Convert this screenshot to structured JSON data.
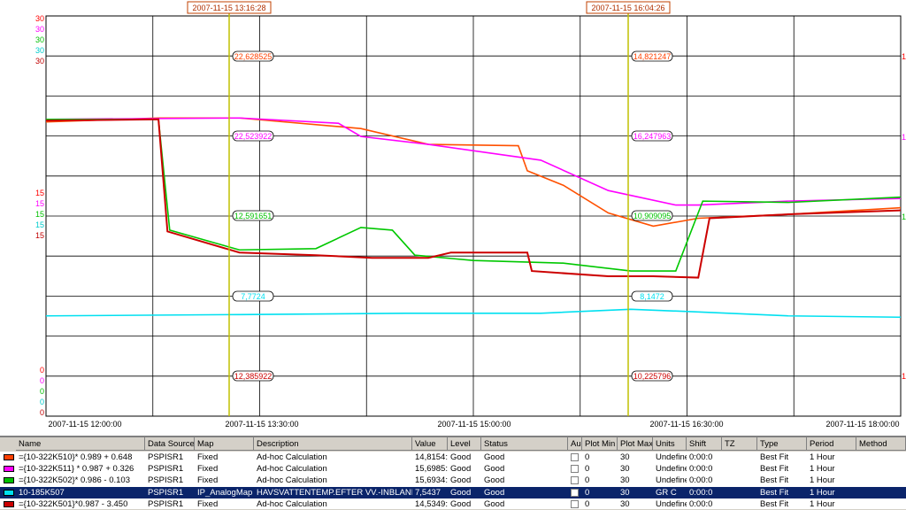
{
  "cursors": [
    {
      "time_label": "2007-11-15  13:16:28",
      "values": [
        "22,628525",
        "22,523922",
        "12,591651",
        "7,7724",
        "12,385922"
      ]
    },
    {
      "time_label": "2007-11-15  16:04:26",
      "values": [
        "14,821247",
        "16,247963",
        "10,909095",
        "8,1472",
        "10,225796"
      ]
    }
  ],
  "y_axis_groups": [
    {
      "label": "30",
      "color": "#ff0000"
    },
    {
      "label": "30",
      "color": "#ff00ff"
    },
    {
      "label": "30",
      "color": "#00c000"
    },
    {
      "label": "30",
      "color": "#00cccc"
    },
    {
      "label": "30",
      "color": "#c00000"
    },
    {
      "label": "15",
      "color": "#ff0000"
    },
    {
      "label": "15",
      "color": "#ff00ff"
    },
    {
      "label": "15",
      "color": "#00c000"
    },
    {
      "label": "15",
      "color": "#00cccc"
    },
    {
      "label": "15",
      "color": "#c00000"
    },
    {
      "label": "0",
      "color": "#ff0000"
    },
    {
      "label": "0",
      "color": "#ff00ff"
    },
    {
      "label": "0",
      "color": "#00c000"
    },
    {
      "label": "0",
      "color": "#00cccc"
    },
    {
      "label": "0",
      "color": "#c00000"
    }
  ],
  "right_axis_labels": [
    "1",
    "1",
    "1",
    "1"
  ],
  "x_ticks": [
    "2007-11-15  12:00:00",
    "2007-11-15  13:30:00",
    "2007-11-15  15:00:00",
    "2007-11-15  16:30:00",
    "2007-11-15  18:00:00"
  ],
  "chart_data": {
    "type": "line",
    "x_range": [
      "2007-11-15 11:50",
      "2007-11-15 18:10"
    ],
    "ylim": [
      0,
      30
    ],
    "grid": true,
    "series": [
      {
        "name": "={10-322K510}* 0.989 + 0.648",
        "color": "#ff5000",
        "points": [
          [
            "11:50",
            22.3
          ],
          [
            "12:40",
            22.6
          ],
          [
            "13:16",
            22.6
          ],
          [
            "14:10",
            21.8
          ],
          [
            "14:40",
            20.6
          ],
          [
            "15:20",
            20.5
          ],
          [
            "15:24",
            18.6
          ],
          [
            "15:40",
            17.5
          ],
          [
            "16:00",
            15.4
          ],
          [
            "16:20",
            14.4
          ],
          [
            "16:40",
            15.0
          ],
          [
            "17:20",
            15.3
          ],
          [
            "18:10",
            15.8
          ]
        ]
      },
      {
        "name": "={10-322K511} * 0.987 + 0.326",
        "color": "#ff00ff",
        "points": [
          [
            "11:50",
            22.5
          ],
          [
            "13:16",
            22.6
          ],
          [
            "14:00",
            22.2
          ],
          [
            "14:10",
            21.2
          ],
          [
            "14:40",
            20.6
          ],
          [
            "15:30",
            19.4
          ],
          [
            "16:00",
            17.1
          ],
          [
            "16:30",
            16.0
          ],
          [
            "16:40",
            16.0
          ],
          [
            "17:20",
            16.3
          ],
          [
            "18:10",
            16.5
          ]
        ]
      },
      {
        "name": "={10-322K502}* 0.986 - 0.103",
        "color": "#00c800",
        "points": [
          [
            "11:50",
            22.5
          ],
          [
            "12:40",
            22.5
          ],
          [
            "12:45",
            14.1
          ],
          [
            "13:16",
            12.6
          ],
          [
            "13:50",
            12.7
          ],
          [
            "14:10",
            14.3
          ],
          [
            "14:24",
            14.1
          ],
          [
            "14:34",
            12.2
          ],
          [
            "15:00",
            11.8
          ],
          [
            "15:40",
            11.6
          ],
          [
            "16:10",
            11.0
          ],
          [
            "16:30",
            11.0
          ],
          [
            "16:42",
            16.3
          ],
          [
            "17:20",
            16.2
          ],
          [
            "18:10",
            16.6
          ]
        ]
      },
      {
        "name": "10-185K507",
        "color": "#00e0f0",
        "points": [
          [
            "11:50",
            7.6
          ],
          [
            "13:16",
            7.7
          ],
          [
            "14:30",
            7.8
          ],
          [
            "15:30",
            7.8
          ],
          [
            "16:10",
            8.1
          ],
          [
            "16:40",
            7.9
          ],
          [
            "17:20",
            7.6
          ],
          [
            "18:10",
            7.5
          ]
        ]
      },
      {
        "name": "={10-322K501}*0.987 - 3.450",
        "color": "#cc0000",
        "points": [
          [
            "11:50",
            22.4
          ],
          [
            "12:40",
            22.5
          ],
          [
            "12:44",
            14.0
          ],
          [
            "13:16",
            12.4
          ],
          [
            "13:50",
            12.2
          ],
          [
            "14:15",
            12.0
          ],
          [
            "14:40",
            12.0
          ],
          [
            "14:50",
            12.4
          ],
          [
            "15:24",
            12.4
          ],
          [
            "15:26",
            11.0
          ],
          [
            "16:00",
            10.6
          ],
          [
            "16:20",
            10.6
          ],
          [
            "16:40",
            10.5
          ],
          [
            "16:45",
            15.0
          ],
          [
            "17:20",
            15.3
          ],
          [
            "18:10",
            15.6
          ]
        ]
      }
    ]
  },
  "legend": {
    "headers": [
      "Name",
      "Data Source",
      "Map",
      "Description",
      "Value",
      "Level",
      "Status",
      "Au",
      "Plot Min",
      "Plot Max",
      "Units",
      "Shift",
      "TZ",
      "Type",
      "Period",
      "Method"
    ],
    "rows": [
      {
        "color": "#ff4000",
        "name": "={10-322K510}* 0.989 + 0.648",
        "source": "PSPISR1",
        "map": "Fixed",
        "description": "Ad-hoc Calculation",
        "value": "14,8154:",
        "level": "Good",
        "status": "Good",
        "plot_min": "0",
        "plot_max": "30",
        "units": "Undefine",
        "shift": "0:00:0",
        "tz": "",
        "type": "Best Fit",
        "period": "1 Hour",
        "method": "",
        "selected": false
      },
      {
        "color": "#ff00ff",
        "name": "={10-322K511} * 0.987 + 0.326",
        "source": "PSPISR1",
        "map": "Fixed",
        "description": "Ad-hoc Calculation",
        "value": "15,6985:",
        "level": "Good",
        "status": "Good",
        "plot_min": "0",
        "plot_max": "30",
        "units": "Undefine",
        "shift": "0:00:0",
        "tz": "",
        "type": "Best Fit",
        "period": "1 Hour",
        "method": "",
        "selected": false
      },
      {
        "color": "#00c000",
        "name": "={10-322K502}* 0.986 - 0.103",
        "source": "PSPISR1",
        "map": "Fixed",
        "description": "Ad-hoc Calculation",
        "value": "15,6934:",
        "level": "Good",
        "status": "Good",
        "plot_min": "0",
        "plot_max": "30",
        "units": "Undefine",
        "shift": "0:00:0",
        "tz": "",
        "type": "Best Fit",
        "period": "1 Hour",
        "method": "",
        "selected": false
      },
      {
        "color": "#00e0f0",
        "name": "10-185K507",
        "source": "PSPISR1",
        "map": "IP_AnalogMap",
        "description": "HAVSVATTENTEMP.EFTER VV.-INBLAND",
        "value": "7,5437",
        "level": "Good",
        "status": "Good",
        "plot_min": "0",
        "plot_max": "30",
        "units": "GR C",
        "shift": "0:00:0",
        "tz": "",
        "type": "Best Fit",
        "period": "1 Hour",
        "method": "",
        "selected": true
      },
      {
        "color": "#cc0000",
        "name": "={10-322K501}*0.987 - 3.450",
        "source": "PSPISR1",
        "map": "Fixed",
        "description": "Ad-hoc Calculation",
        "value": "14,5349:",
        "level": "Good",
        "status": "Good",
        "plot_min": "0",
        "plot_max": "30",
        "units": "Undefine",
        "shift": "0:00:0",
        "tz": "",
        "type": "Best Fit",
        "period": "1 Hour",
        "method": "",
        "selected": false
      }
    ]
  }
}
